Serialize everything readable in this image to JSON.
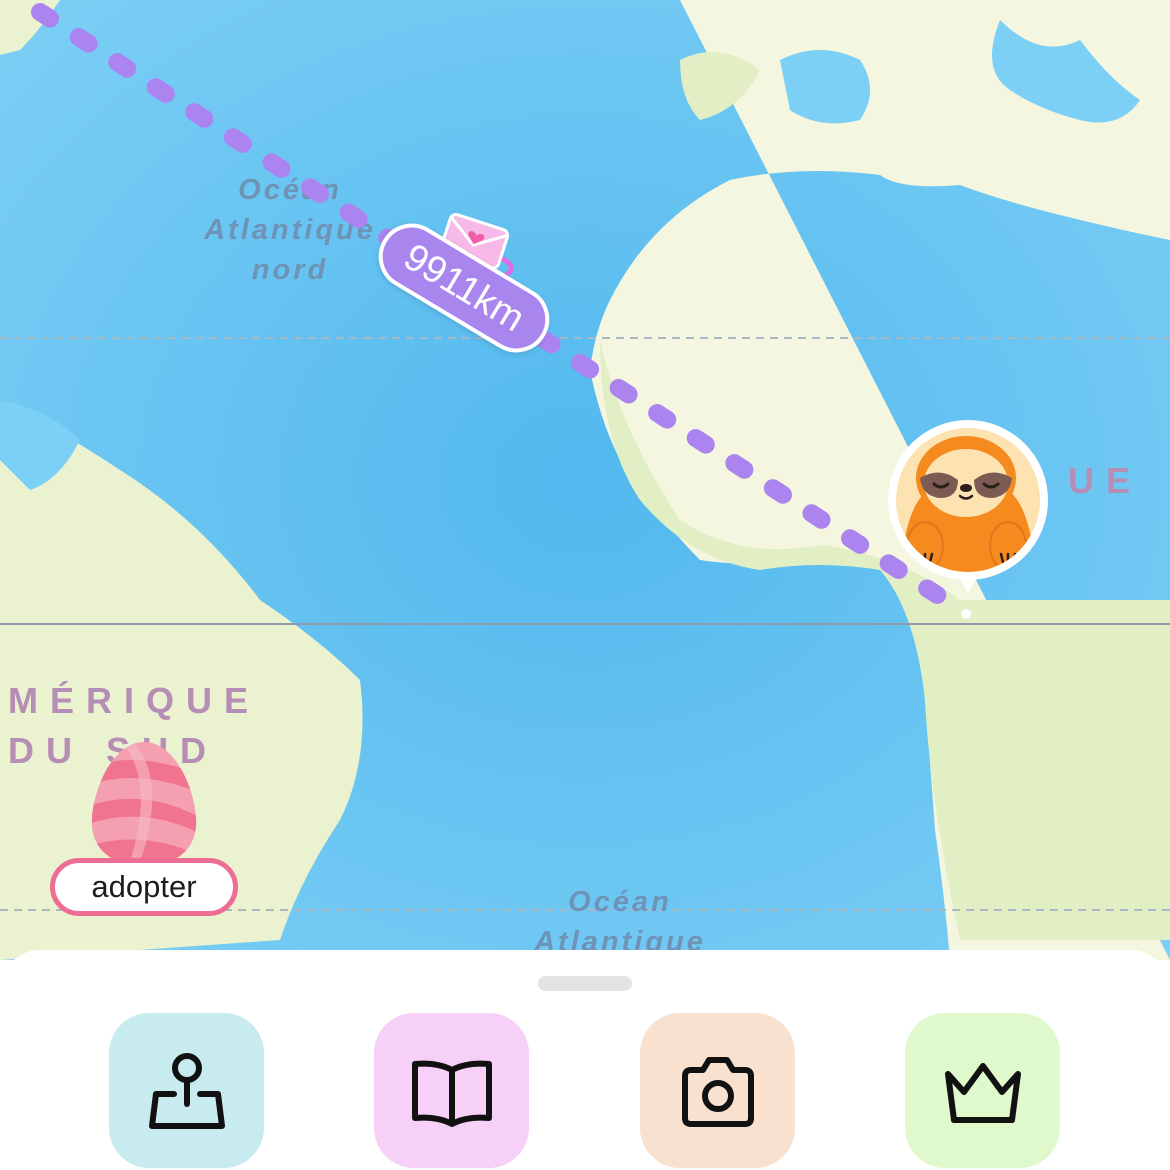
{
  "map": {
    "ocean_labels": {
      "north_atlantic": "Océan\nAtlantique\nnord",
      "south_atlantic": "Océan\nAtlantique"
    },
    "region_labels": {
      "south_america": "MÉRIQUE\nDU SUD",
      "africa_partial": "UE"
    },
    "route": {
      "distance_label": "9911km",
      "color": "#ab84f0"
    },
    "markers": {
      "sloth": "sloth-avatar",
      "envelope": "love-letter-envelope",
      "egg": "pink-striped-egg"
    },
    "adopt_label": "adopter"
  },
  "toolbar": {
    "buttons": [
      {
        "icon": "map-pin-icon",
        "color": "#c8ebf0"
      },
      {
        "icon": "book-icon",
        "color": "#f6d0f6"
      },
      {
        "icon": "camera-icon",
        "color": "#f9e1d0"
      },
      {
        "icon": "crown-icon",
        "color": "#dff8cc"
      }
    ]
  },
  "colors": {
    "ocean": "#63bfee",
    "land": "#eef3d3",
    "accent_pink": "#ec6f93",
    "accent_purple": "#ab84f0"
  }
}
